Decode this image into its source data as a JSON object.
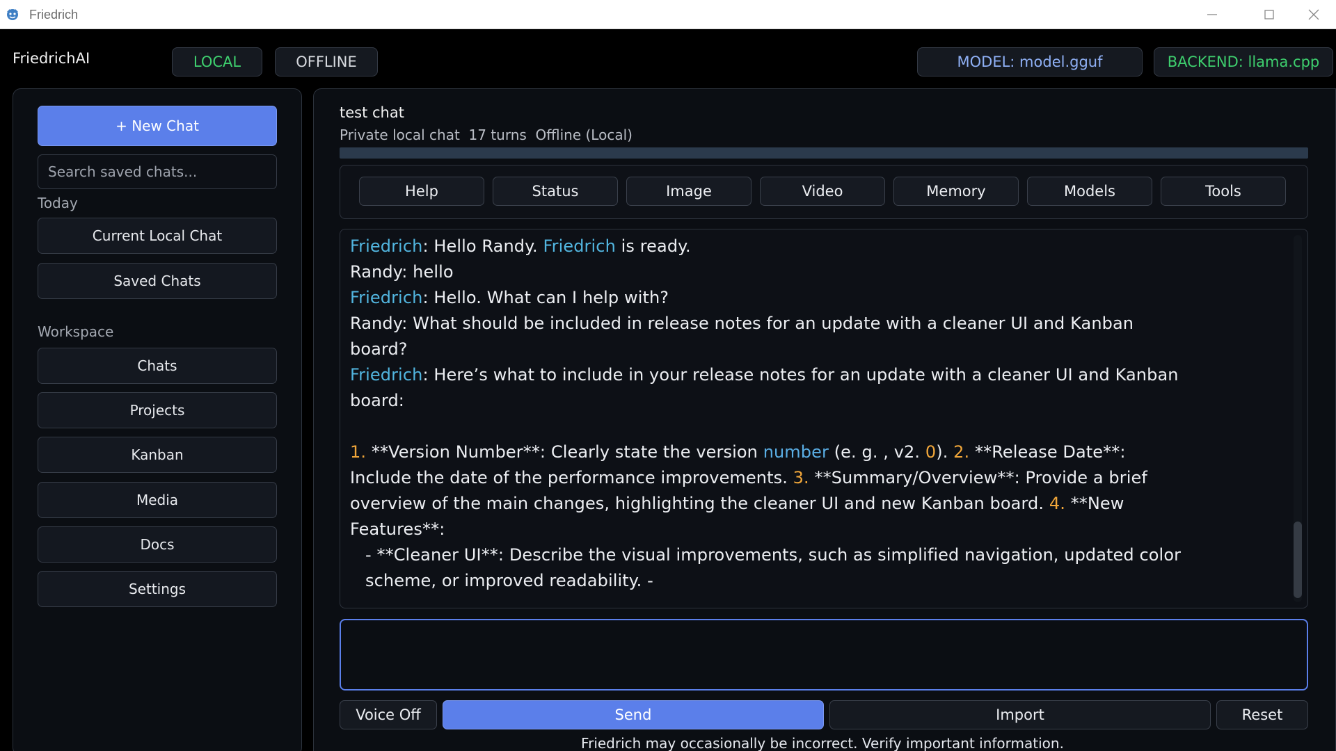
{
  "window": {
    "title": "Friedrich"
  },
  "header": {
    "brand": "FriedrichAI",
    "mode_local": "LOCAL",
    "mode_offline": "OFFLINE",
    "model": "MODEL: model.gguf",
    "backend": "BACKEND: llama.cpp"
  },
  "sidebar": {
    "new_chat": "+  New Chat",
    "search_placeholder": "Search saved chats...",
    "today_label": "Today",
    "today_items": [
      "Current Local Chat",
      "Saved Chats"
    ],
    "workspace_label": "Workspace",
    "workspace_items": [
      "Chats",
      "Projects",
      "Kanban",
      "Media",
      "Docs",
      "Settings"
    ]
  },
  "chat": {
    "title": "test chat",
    "meta": "Private local chat  17 turns  Offline (Local)",
    "tabs": [
      "Help",
      "Status",
      "Image",
      "Video",
      "Memory",
      "Models",
      "Tools"
    ],
    "messages": {
      "l1_speaker": "Friedrich",
      "l1_a": ": Hello Randy. ",
      "l1_name": "Friedrich",
      "l1_b": " is ready.",
      "l2": "Randy: hello",
      "l3_speaker": "Friedrich",
      "l3_text": ": Hello. What can I help with?",
      "l4": "Randy: What should be included in release notes for an update with a cleaner UI and Kanban",
      "l5": "board?",
      "l6_speaker": "Friedrich",
      "l6_text": ": Here’s what to include in your release notes for an update with a cleaner UI and Kanban",
      "l7": "board:",
      "l9_n1": "1.",
      "l9_a": " **Version Number**: Clearly state the version ",
      "l9_word": "number",
      "l9_b": " (e. g. , v2. ",
      "l9_zero": "0",
      "l9_c": "). ",
      "l9_n2": "2.",
      "l9_d": " **Release Date**:",
      "l10_a": "Include the date of the performance improvements. ",
      "l10_n3": "3.",
      "l10_b": " **Summary/Overview**: Provide a brief",
      "l11_a": "overview of the main changes, highlighting the cleaner UI and new Kanban board. ",
      "l11_n4": "4.",
      "l11_b": " **New",
      "l12": "Features**:",
      "l13": "- **Cleaner UI**: Describe the visual improvements, such as simplified navigation, updated color",
      "l14": "scheme, or improved readability. -"
    }
  },
  "composer": {
    "value": ""
  },
  "actions": {
    "voice": "Voice Off",
    "send": "Send",
    "import": "Import",
    "reset": "Reset"
  },
  "disclaimer": "Friedrich may occasionally be incorrect. Verify important information.",
  "colors": {
    "accent": "#5b7fea",
    "local_green": "#3ecf6e",
    "model_blue": "#8fb0f5",
    "backend_green": "#3ecf6e",
    "speaker_blue": "#52b6e0",
    "number_orange": "#f0a63a"
  }
}
